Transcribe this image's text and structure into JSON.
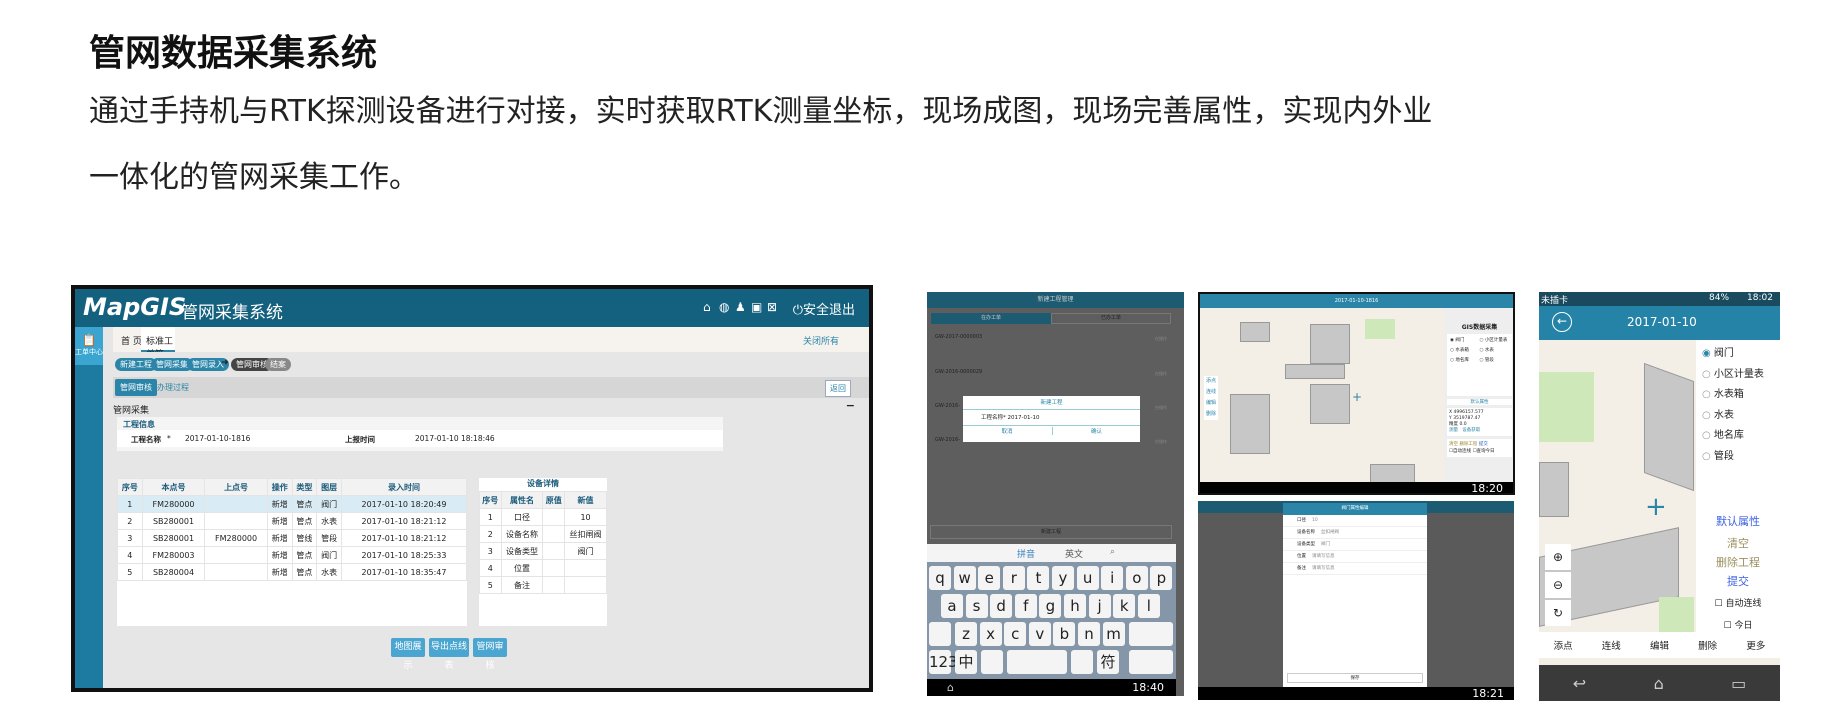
{
  "heading": {
    "title": "管网数据采集系统",
    "line1": "通过手持机与RTK探测设备进行对接，实时获取RTK测量坐标，现场成图，现场完善属性，实现内外业",
    "line2": "一体化的管网采集工作。"
  },
  "desktop": {
    "logo": "MapGIS",
    "app_title": "管网采集系统",
    "header_icons": [
      "home-icon",
      "globe-icon",
      "user-icon",
      "book-icon",
      "mail-icon"
    ],
    "logout": "安全退出",
    "sidebar": {
      "item": "工单中心"
    },
    "tabs": [
      "首 页",
      "标准工单箱"
    ],
    "close_all": "关闭所有",
    "steps": [
      "新建工程",
      "管网采集",
      "管网录入",
      "管网审核",
      "结案"
    ],
    "subtabs": [
      "管网审核",
      "办理过程"
    ],
    "back": "返回",
    "section": "管网采集",
    "collapse": "−",
    "info": {
      "title": "工程信息",
      "name_label": "工程名称",
      "required": "*",
      "name_value": "2017-01-10-1816",
      "time_label": "上报时间",
      "time_value": "2017-01-10 18:18:46"
    },
    "points": {
      "headers": [
        "序号",
        "本点号",
        "上点号",
        "操作",
        "类型",
        "图层",
        "录入时间"
      ],
      "rows": [
        [
          "1",
          "FM280000",
          "",
          "新增",
          "管点",
          "阀门",
          "2017-01-10 18:20:49"
        ],
        [
          "2",
          "SB280001",
          "",
          "新增",
          "管点",
          "水表",
          "2017-01-10 18:21:12"
        ],
        [
          "3",
          "SB280001",
          "FM280000",
          "新增",
          "管线",
          "管段",
          "2017-01-10 18:21:12"
        ],
        [
          "4",
          "FM280003",
          "",
          "新增",
          "管点",
          "阀门",
          "2017-01-10 18:25:33"
        ],
        [
          "5",
          "SB280004",
          "",
          "新增",
          "管点",
          "水表",
          "2017-01-10 18:35:47"
        ]
      ]
    },
    "details": {
      "title": "设备详情",
      "headers": [
        "序号",
        "属性名",
        "原值",
        "新值"
      ],
      "rows": [
        [
          "1",
          "口径",
          "",
          "10"
        ],
        [
          "2",
          "设备名称",
          "",
          "丝扣闸阀"
        ],
        [
          "3",
          "设备类型",
          "",
          "阀门"
        ],
        [
          "4",
          "位置",
          "",
          ""
        ],
        [
          "5",
          "备注",
          "",
          ""
        ]
      ]
    },
    "buttons": [
      "地图展示",
      "导出点线表",
      "管网审核"
    ]
  },
  "phone1": {
    "title": "新建工程管理",
    "tabs": [
      "在办工单",
      "已办工单"
    ],
    "list": [
      {
        "id": "GW-2017-0000003",
        "status": "在操作"
      },
      {
        "id": "GW-2016-0000029",
        "status": "在操作"
      },
      {
        "id": "GW-2016-",
        "status": "在操作"
      },
      {
        "id": "GW-2016-",
        "status": "在操作"
      }
    ],
    "dialog": {
      "title": "新建工程",
      "label": "工程名称*",
      "value": "2017-01-10",
      "cancel": "取消",
      "ok": "确认"
    },
    "new_button": "新建工程",
    "ime": {
      "pinyin": "拼音",
      "english": "英文"
    },
    "keys": {
      "row1": [
        "q",
        "w",
        "e",
        "r",
        "t",
        "y",
        "u",
        "i",
        "o",
        "p"
      ],
      "row2": [
        "a",
        "s",
        "d",
        "f",
        "g",
        "h",
        "j",
        "k",
        "l"
      ],
      "row3": [
        "z",
        "x",
        "c",
        "v",
        "b",
        "n",
        "m"
      ],
      "num": "123",
      "zh": "中",
      "sym": "符"
    },
    "clock": "18:40"
  },
  "tablet1": {
    "title": "2017-01-10-1816",
    "panel_title": "GIS数据采集",
    "layers": [
      "阀门",
      "小区计量表",
      "水表箱",
      "水表",
      "地名库",
      "管段"
    ],
    "default_attr": "默认属性",
    "x_label": "X",
    "x": "4996157.577",
    "y_label": "Y",
    "y": "3519787.47",
    "acc_label": "精度",
    "acc": "0.0",
    "measure": "测量",
    "device": "设备获取",
    "clear": "清空",
    "delete": "删除工程",
    "submit": "提交",
    "auto": "自动连线",
    "today": "查询今日",
    "tools": [
      "添点",
      "连线",
      "编辑",
      "删除"
    ],
    "clock": "18:20"
  },
  "tablet2": {
    "dialog_title": "阀门属性编辑",
    "fields": [
      {
        "label": "口径",
        "value": "10"
      },
      {
        "label": "设备名称",
        "value": "丝扣闸阀"
      },
      {
        "label": "设备类型",
        "value": "阀门"
      },
      {
        "label": "位置",
        "value": "请填写信息"
      },
      {
        "label": "备注",
        "value": "请填写信息"
      }
    ],
    "save": "保存",
    "clock": "18:21"
  },
  "phone2": {
    "status": {
      "carrier": "未插卡",
      "battery": "84%",
      "clock": "18:02"
    },
    "title": "2017-01-10",
    "layers": [
      "阀门",
      "小区计量表",
      "水表箱",
      "水表",
      "地名库",
      "管段"
    ],
    "selected_layer": "阀门",
    "default_attr": "默认属性",
    "clear": "清空",
    "delete": "删除工程",
    "submit": "提交",
    "auto": "自动连线",
    "today": "今日",
    "tools": [
      "添点",
      "连线",
      "编辑",
      "删除",
      "更多"
    ]
  }
}
